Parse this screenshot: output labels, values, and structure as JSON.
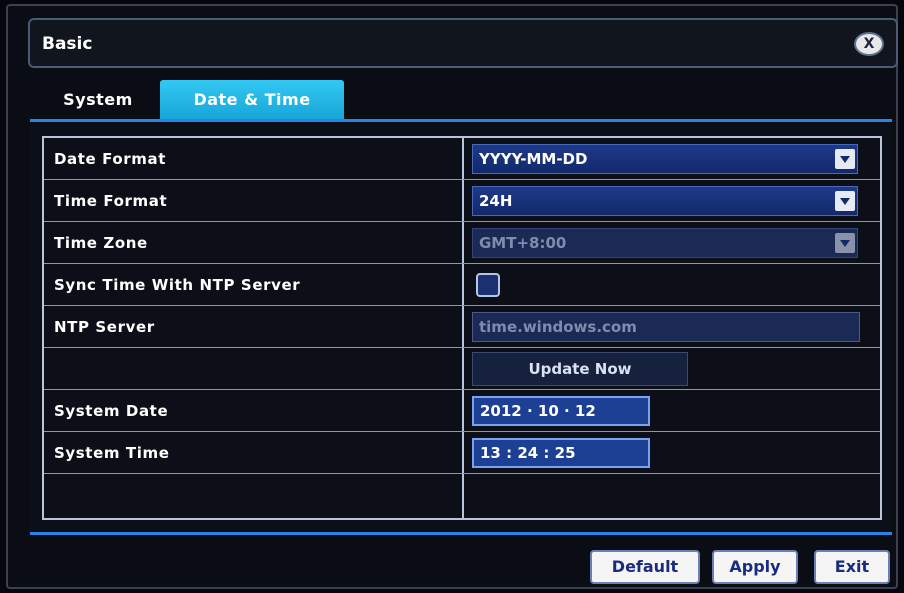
{
  "window": {
    "title": "Basic",
    "close_label": "X"
  },
  "tabs": [
    {
      "label": "System",
      "active": false
    },
    {
      "label": "Date & Time",
      "active": true
    }
  ],
  "settings": {
    "date_format": {
      "label": "Date Format",
      "value": "YYYY-MM-DD"
    },
    "time_format": {
      "label": "Time Format",
      "value": "24H"
    },
    "time_zone": {
      "label": "Time Zone",
      "value": "GMT+8:00",
      "disabled": true
    },
    "ntp_sync": {
      "label": "Sync Time With NTP Server",
      "checked": false
    },
    "ntp_server": {
      "label": "NTP Server",
      "value": "time.windows.com",
      "disabled": true
    },
    "update_now": {
      "label": "Update Now"
    },
    "system_date": {
      "label": "System Date",
      "value": "2012  ·  10  ·  12"
    },
    "system_time": {
      "label": "System Time",
      "value": "13 : 24 : 25"
    }
  },
  "footer": {
    "default_label": "Default",
    "apply_label": "Apply",
    "exit_label": "Exit"
  },
  "colors": {
    "accent": "#2a84e6",
    "tab_active": "#22b4e4",
    "field_bg": "#1d3f94"
  }
}
